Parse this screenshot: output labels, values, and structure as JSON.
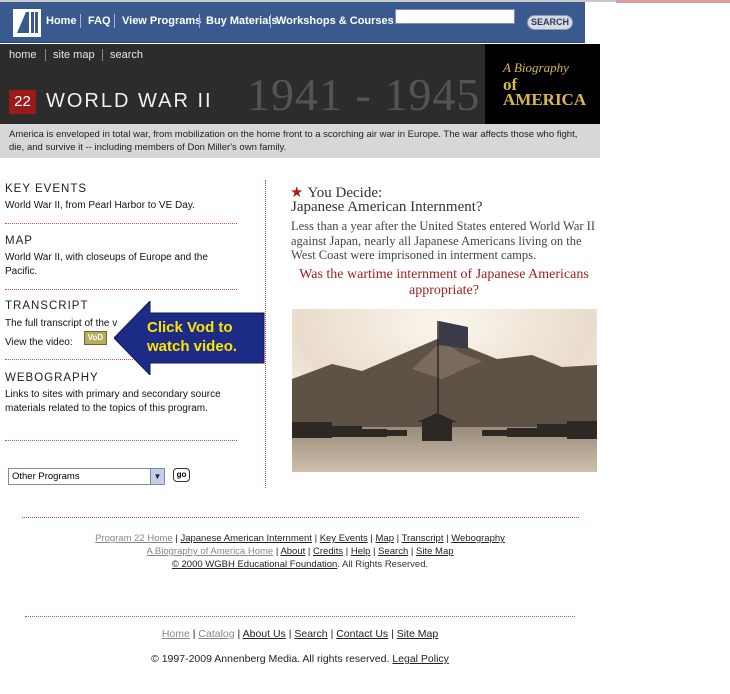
{
  "header": {
    "nav_items": [
      "Home",
      "FAQ",
      "View Programs",
      "Buy Materials",
      "Workshops & Courses"
    ],
    "search_placeholder": "",
    "search_button": "SEARCH"
  },
  "banner": {
    "sub_nav": [
      "home",
      "site map",
      "search"
    ],
    "program_number": "22",
    "program_title": "WORLD WAR II",
    "years": "1941 - 1945",
    "series_logo_line1": "A Biography",
    "series_logo_line2": "of AMERICA"
  },
  "intro": "America is enveloped in total war, from mobilization on the home front to a scorching air war in Europe. The war affects those who fight, die, and survive it -- including members of Don Miller's own family.",
  "sections": {
    "key_events": {
      "title": "KEY EVENTS",
      "text": "World War II, from Pearl Harbor to VE Day."
    },
    "map": {
      "title": "MAP",
      "text": "World War II, with closeups of Europe and the Pacific."
    },
    "transcript": {
      "title": "TRANSCRIPT",
      "text": "The full transcript of the v",
      "video_label": "View the video:",
      "vod_badge": "VoD"
    },
    "webography": {
      "title": "WEBOGRAPHY",
      "text": "Links to sites with primary and secondary source materials related to the topics of this program."
    }
  },
  "program_select": {
    "selected": "Other Programs",
    "go": "go"
  },
  "callout": {
    "line1": "Click Vod to",
    "line2": "watch video."
  },
  "you_decide": {
    "heading": "You Decide:",
    "title": "Japanese American Internment?",
    "description": "Less than a year after the United States entered World War II against Japan, nearly all Japanese Americans living on the West Coast were imprisoned in interment camps.",
    "question": "Was the wartime internment of Japanese Americans appropriate?"
  },
  "footer": {
    "line1": [
      "Program 22 Home",
      "Japanese American Internment",
      "Key Events",
      "Map",
      "Transcript",
      "Webography"
    ],
    "line2": [
      "A Biography of America Home",
      "About",
      "Credits",
      "Help",
      "Search",
      "Site Map"
    ],
    "copyright_link": "© 2000 WGBH Educational Foundation",
    "copyright_rest": ". All Rights Reserved.",
    "bottom_links": [
      "Home",
      "Catalog",
      "About Us",
      "Search",
      "Contact Us",
      "Site Map"
    ],
    "bottom_copyright": "© 1997-2009 Annenberg Media. All rights reserved.",
    "legal_policy": "Legal Policy"
  }
}
